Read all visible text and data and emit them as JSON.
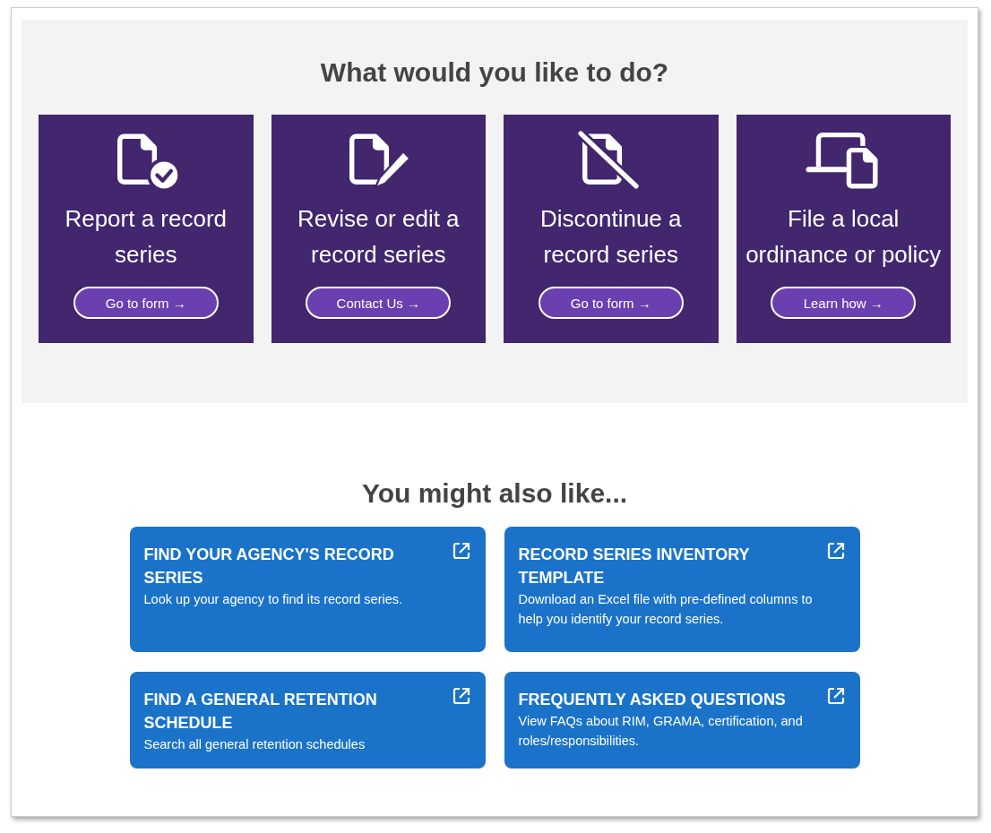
{
  "actions": {
    "heading": "What would you like to do?",
    "cards": [
      {
        "kind": "report",
        "title": "Report a record series",
        "button": "Go to form",
        "arrow": "→"
      },
      {
        "kind": "revise",
        "title": "Revise or edit a record series",
        "button": "Contact Us",
        "arrow": "→"
      },
      {
        "kind": "discontinue",
        "title": "Discontinue a record series",
        "button": "Go to form",
        "arrow": "→"
      },
      {
        "kind": "file",
        "title": "File a local ordinance or policy",
        "button": "Learn how",
        "arrow": "→"
      }
    ]
  },
  "related": {
    "heading": "You might also like...",
    "links": [
      {
        "title": "FIND YOUR AGENCY'S RECORD SERIES",
        "description": "Look up your agency to find its record series."
      },
      {
        "title": "RECORD SERIES INVENTORY TEMPLATE",
        "description": "Download an Excel file with pre-defined columns to help you identify your record series."
      },
      {
        "title": "FIND A GENERAL RETENTION SCHEDULE",
        "description": "Search all general retention schedules"
      },
      {
        "title": "FREQUENTLY ASKED QUESTIONS",
        "description": "View FAQs about RIM, GRAMA, certification, and roles/responsibilities."
      }
    ]
  }
}
